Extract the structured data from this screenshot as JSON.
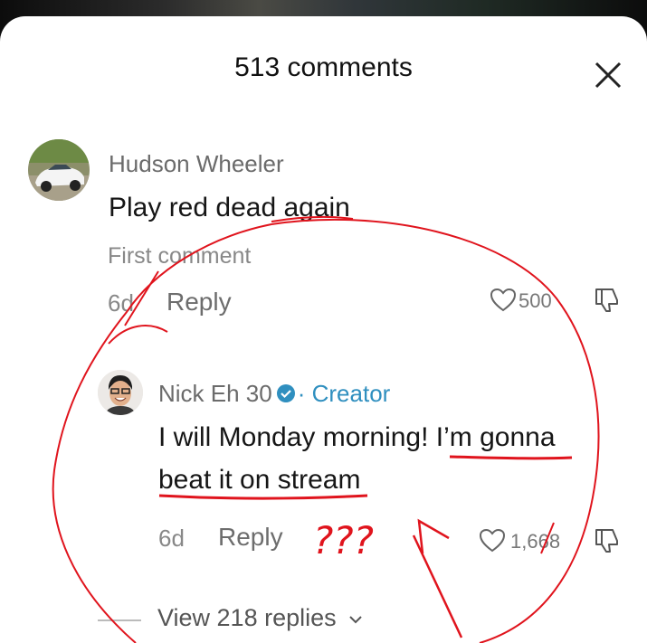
{
  "header": {
    "title": "513 comments"
  },
  "comments": [
    {
      "author": "Hudson Wheeler",
      "text": "Play red dead again",
      "badge": "First comment",
      "age": "6d",
      "reply_label": "Reply",
      "likes": "500"
    },
    {
      "author": "Nick Eh 30",
      "role": "· Creator",
      "text_line1": "I will Monday morning! I’m gonna",
      "text_line2": "beat it on stream",
      "age": "6d",
      "reply_label": "Reply",
      "likes": "1,668",
      "view_replies": "View 218 replies"
    }
  ],
  "annotation": {
    "marks": "???"
  },
  "colors": {
    "creator": "#2f8fbf",
    "annotation": "#e0141d",
    "text": "#161616"
  }
}
